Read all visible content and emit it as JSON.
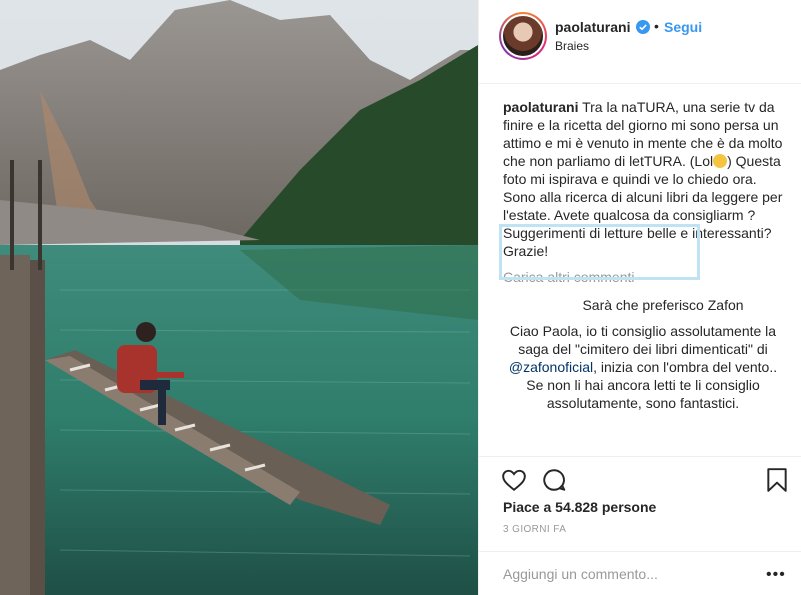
{
  "header": {
    "username": "paolaturani",
    "follow_label": "Segui",
    "separator": "•",
    "location": "Braies"
  },
  "caption": {
    "username": "paolaturani",
    "text_part1": "Tra la naTURA, una serie tv da finire e la ricetta del giorno mi sono persa un attimo e mi è venuto in mente che è da molto che non parliamo di letTURA. (Lol",
    "emoji_icon": "rolling-laughing-emoji",
    "text_part2": ") Questa foto mi ispirava e quindi ve lo chiedo ora. Sono alla ricerca di alcuni libri da leggere per l'estate. Avete qualcosa da consigliarm ? Suggerimenti di letture belle e interessanti? Grazie!"
  },
  "load_more": "Carica altri commenti",
  "comments": [
    {
      "text": "Sarà che preferisco Zafon"
    },
    {
      "text_part1": "Ciao Paola, io ti consiglio assolutamente la saga del \"cimitero dei libri dimenticati\" di ",
      "mention": "@zafonoficial",
      "text_part2": ", inizia con l'ombra del vento.. Se non li hai ancora letti te li consiglio assolutamente, sono fantastici."
    }
  ],
  "actions": {
    "likes": "Piace a 54.828 persone",
    "time": "3 GIORNI FA",
    "add_comment_placeholder": "Aggiungi un commento...",
    "more_label": "•••"
  },
  "colors": {
    "accent": "#3897f0",
    "highlight": "#bfe3f2",
    "muted": "#999999"
  }
}
